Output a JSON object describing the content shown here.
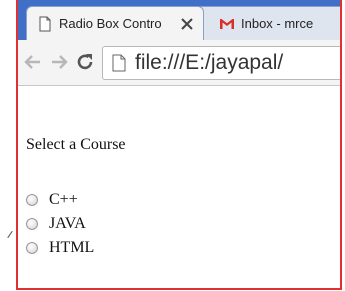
{
  "browser": {
    "tabs": [
      {
        "title": "Radio Box Contro",
        "icon": "page-icon",
        "active": true
      },
      {
        "title": "Inbox - mrce",
        "icon": "gmail-icon",
        "active": false
      }
    ],
    "close_glyph": "✕",
    "url": "file:///E:/jayapal/",
    "colors": {
      "tabstrip": "#3f6fc6",
      "window_border": "#e03030",
      "gmail_red": "#d93025"
    }
  },
  "page": {
    "heading": "Select a Course",
    "options": [
      {
        "label": "C++",
        "checked": false
      },
      {
        "label": "JAVA",
        "checked": false
      },
      {
        "label": "HTML",
        "checked": false
      }
    ]
  }
}
